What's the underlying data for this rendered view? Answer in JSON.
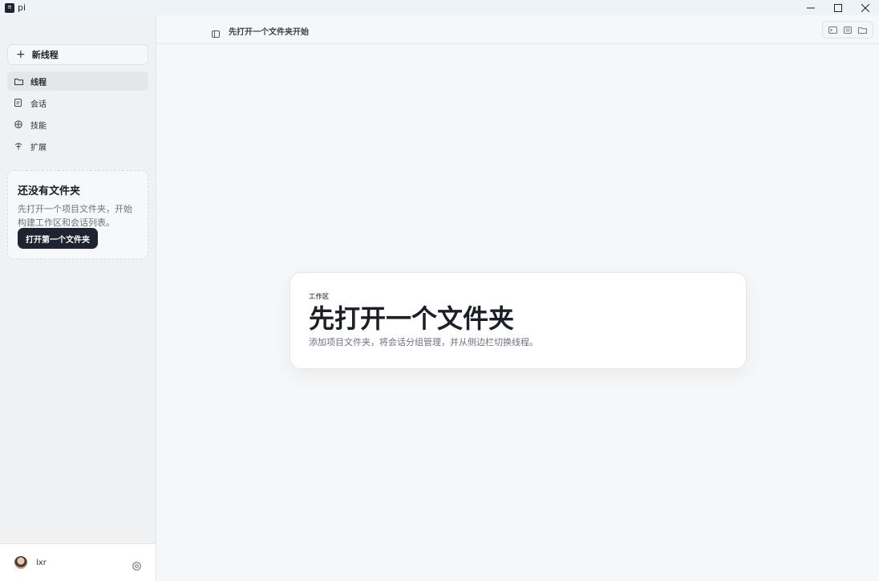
{
  "window": {
    "title": "pi",
    "logo_glyph": "π",
    "controls": {
      "minimize": "—",
      "maximize": "☐",
      "close": "✕"
    }
  },
  "sidebar": {
    "new_thread_label": "新线程",
    "new_thread_icon": "+",
    "items": [
      {
        "label": "线程",
        "icon": "folder-icon",
        "active": true
      },
      {
        "label": "会话",
        "icon": "document-icon",
        "active": false
      },
      {
        "label": "技能",
        "icon": "cube-icon",
        "active": false
      },
      {
        "label": "扩展",
        "icon": "plug-icon",
        "active": false
      }
    ],
    "empty_state": {
      "title": "还没有文件夹",
      "description": "先打开一个项目文件夹，开始构建工作区和会话列表。",
      "button_label": "打开第一个文件夹"
    },
    "footer": {
      "username": "lxr"
    }
  },
  "topbar": {
    "title": "先打开一个文件夹开始",
    "actions": [
      "terminal-icon",
      "notes-icon",
      "folder-icon"
    ]
  },
  "main": {
    "eyebrow": "工作区",
    "title": "先打开一个文件夹",
    "subtitle": "添加项目文件夹，将会话分组管理，并从侧边栏切换线程。"
  },
  "colors": {
    "background": "#f6f7f9",
    "sidebar": "#f0f1f3",
    "primary_button": "#1e2430",
    "card": "#ffffff"
  }
}
